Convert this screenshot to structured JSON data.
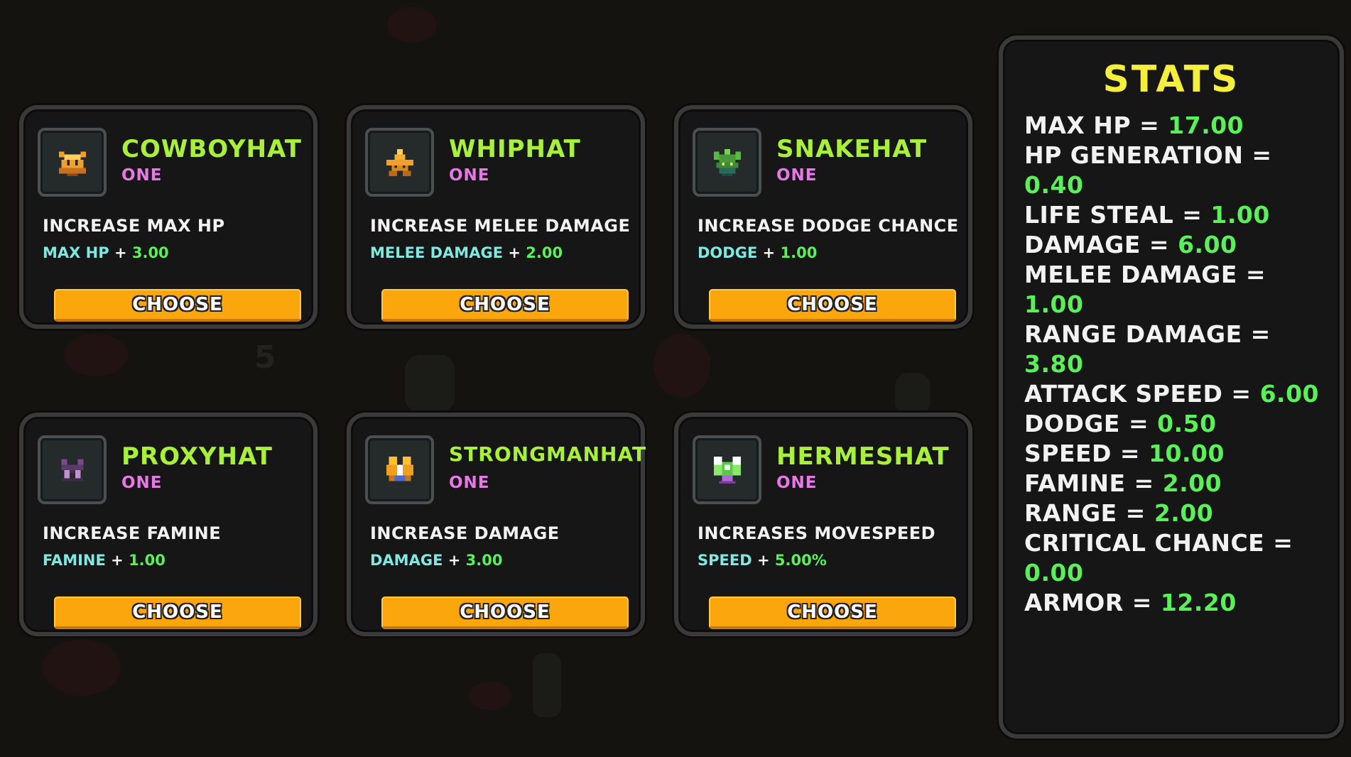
{
  "cards": [
    {
      "name": "COWBOYHAT",
      "tier": "ONE",
      "description": "INCREASE MAX HP",
      "effect_stat": "MAX HP",
      "effect_op": "+",
      "effect_value": "3.00",
      "button": "CHOOSE",
      "icon": "cowboyhat-icon"
    },
    {
      "name": "WHIPHAT",
      "tier": "ONE",
      "description": "INCREASE MELEE DAMAGE",
      "effect_stat": "MELEE DAMAGE",
      "effect_op": "+",
      "effect_value": "2.00",
      "button": "CHOOSE",
      "icon": "whiphat-icon"
    },
    {
      "name": "SNAKEHAT",
      "tier": "ONE",
      "description": "INCREASE DODGE CHANCE",
      "effect_stat": "DODGE",
      "effect_op": "+",
      "effect_value": "1.00",
      "button": "CHOOSE",
      "icon": "snakehat-icon"
    },
    {
      "name": "PROXYHAT",
      "tier": "ONE",
      "description": "INCREASE FAMINE",
      "effect_stat": "FAMINE",
      "effect_op": "+",
      "effect_value": "1.00",
      "button": "CHOOSE",
      "icon": "proxyhat-icon"
    },
    {
      "name": "STRONGMANHAT",
      "tier": "ONE",
      "description": "INCREASE DAMAGE",
      "effect_stat": "DAMAGE",
      "effect_op": "+",
      "effect_value": "3.00",
      "button": "CHOOSE",
      "icon": "strongmanhat-icon"
    },
    {
      "name": "HERMESHAT",
      "tier": "ONE",
      "description": "INCREASES MOVESPEED",
      "effect_stat": "SPEED",
      "effect_op": "+",
      "effect_value": "5.00%",
      "button": "CHOOSE",
      "icon": "hermeshat-icon"
    }
  ],
  "stats": {
    "title": "STATS",
    "lines": [
      {
        "label": "MAX HP =",
        "value": "17.00"
      },
      {
        "label": "HP GENERATION =",
        "value": "0.40"
      },
      {
        "label": "LIFE STEAL =",
        "value": "1.00"
      },
      {
        "label": "DAMAGE =",
        "value": "6.00"
      },
      {
        "label": "MELEE DAMAGE =",
        "value": "1.00"
      },
      {
        "label": "RANGE DAMAGE =",
        "value": "3.80"
      },
      {
        "label": "ATTACK SPEED =",
        "value": "6.00"
      },
      {
        "label": "DODGE =",
        "value": "0.50"
      },
      {
        "label": "SPEED =",
        "value": "10.00"
      },
      {
        "label": "FAMINE =",
        "value": "2.00"
      },
      {
        "label": "RANGE =",
        "value": "2.00"
      },
      {
        "label": "CRITICAL CHANCE =",
        "value": "0.00"
      },
      {
        "label": "ARMOR =",
        "value": "12.20"
      }
    ]
  },
  "background_number": "5",
  "colors": {
    "item_name": "#a8f03c",
    "tier": "#e878e8",
    "effect_stat": "#7fe8e0",
    "value_green": "#5af05a",
    "button": "#fba60c",
    "stats_title": "#f5ee3a"
  }
}
